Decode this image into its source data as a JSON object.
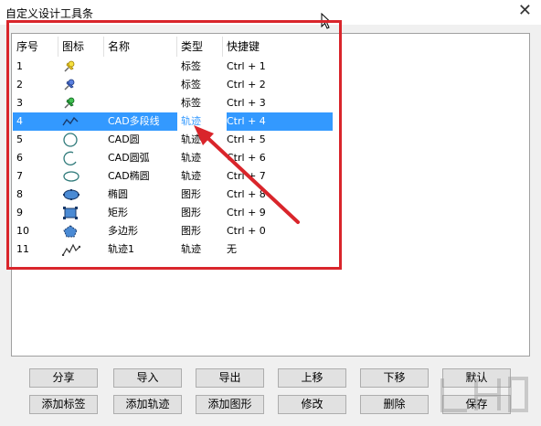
{
  "window": {
    "title": "自定义设计工具条",
    "close_glyph": "✕"
  },
  "table": {
    "headers": [
      "序号",
      "图标",
      "名称",
      "类型",
      "快捷键"
    ],
    "rows": [
      {
        "index": "1",
        "icon": "yellow-pushpin-icon",
        "name": "",
        "type": "标签",
        "shortcut": "Ctrl + 1"
      },
      {
        "index": "2",
        "icon": "blue-pushpin-icon",
        "name": "",
        "type": "标签",
        "shortcut": "Ctrl + 2"
      },
      {
        "index": "3",
        "icon": "green-pushpin-icon",
        "name": "",
        "type": "标签",
        "shortcut": "Ctrl + 3"
      },
      {
        "index": "4",
        "icon": "polyline-icon",
        "name": "CAD多段线",
        "type": "轨迹",
        "shortcut": "Ctrl + 4",
        "selected": true
      },
      {
        "index": "5",
        "icon": "circle-icon",
        "name": "CAD圆",
        "type": "轨迹",
        "shortcut": "Ctrl + 5"
      },
      {
        "index": "6",
        "icon": "arc-icon",
        "name": "CAD圆弧",
        "type": "轨迹",
        "shortcut": "Ctrl + 6"
      },
      {
        "index": "7",
        "icon": "ellipse-icon",
        "name": "CAD椭圆",
        "type": "轨迹",
        "shortcut": "Ctrl + 7"
      },
      {
        "index": "8",
        "icon": "filled-ellipse-icon",
        "name": "椭圆",
        "type": "图形",
        "shortcut": "Ctrl + 8"
      },
      {
        "index": "9",
        "icon": "rectangle-icon",
        "name": "矩形",
        "type": "图形",
        "shortcut": "Ctrl + 9"
      },
      {
        "index": "10",
        "icon": "polygon-icon",
        "name": "多边形",
        "type": "图形",
        "shortcut": "Ctrl + 0"
      },
      {
        "index": "11",
        "icon": "track-icon",
        "name": "轨迹1",
        "type": "轨迹",
        "shortcut": "无"
      }
    ]
  },
  "buttons": {
    "share": "分享",
    "import": "导入",
    "export": "导出",
    "move_up": "上移",
    "move_down": "下移",
    "default": "默认",
    "add_label": "添加标签",
    "add_track": "添加轨迹",
    "add_shape": "添加图形",
    "modify": "修改",
    "delete": "删除",
    "save": "保存"
  },
  "colors": {
    "selection": "#3399ff",
    "highlight_box": "#d9252b",
    "icon_blue": "#4a8ad4"
  }
}
